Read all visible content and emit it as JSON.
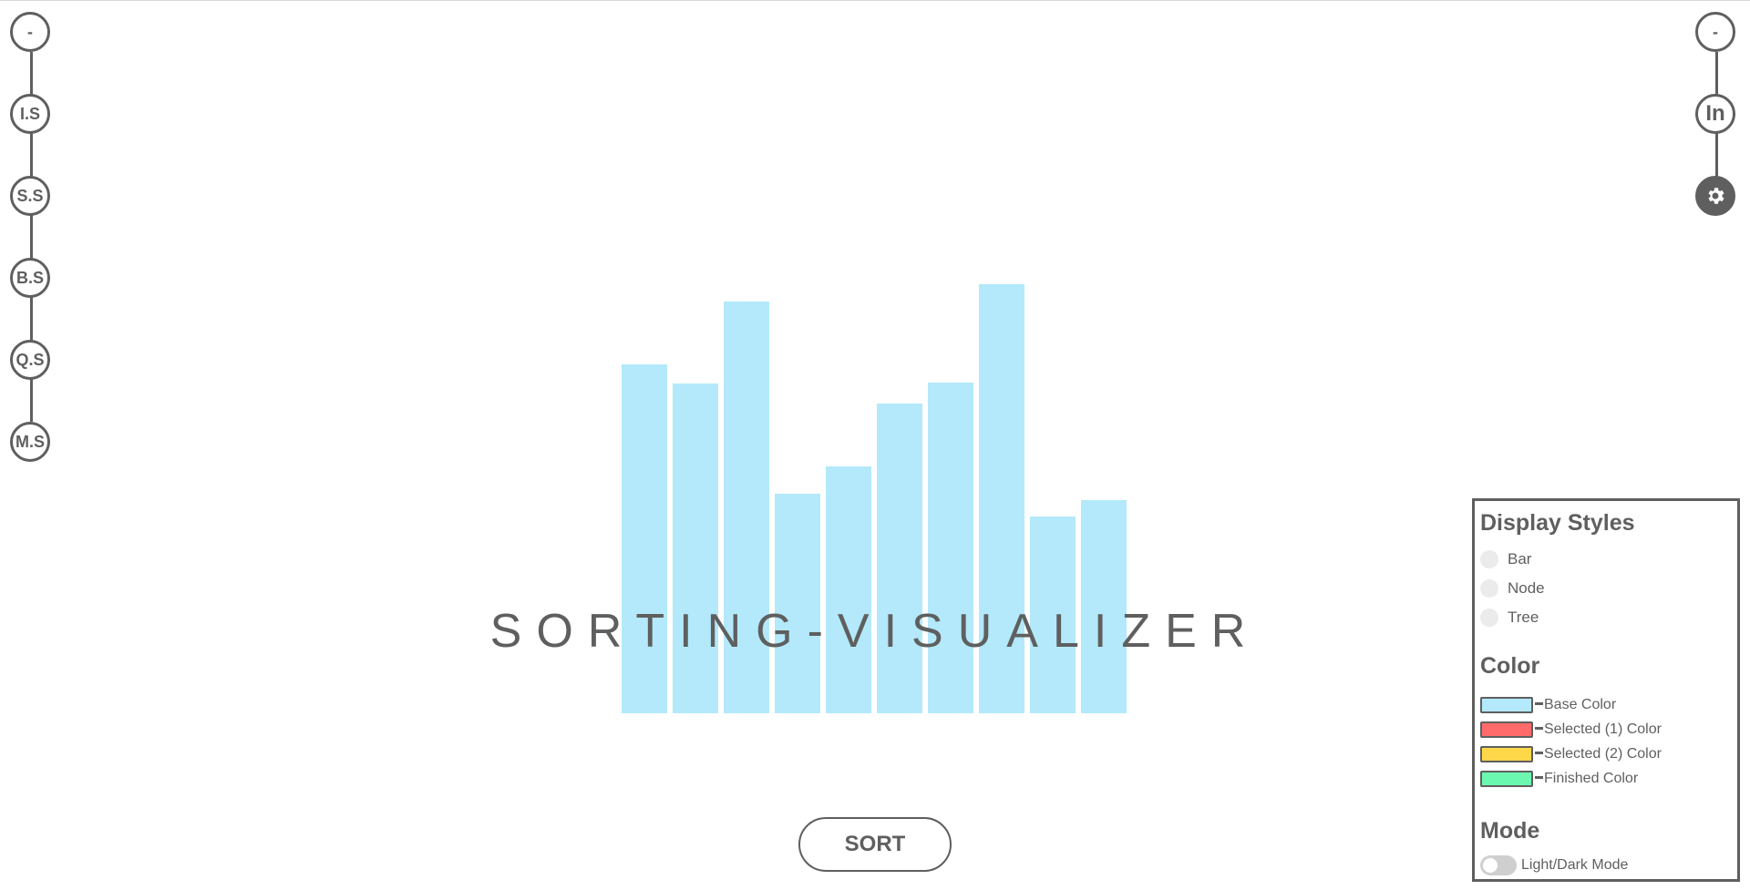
{
  "left_nav": {
    "items": [
      {
        "label": "-"
      },
      {
        "label": "I.S"
      },
      {
        "label": "S.S"
      },
      {
        "label": "B.S"
      },
      {
        "label": "Q.S"
      },
      {
        "label": "M.S"
      }
    ]
  },
  "right_nav": {
    "items": [
      {
        "label": "-"
      },
      {
        "label": "In"
      },
      {
        "icon": "gear-icon"
      }
    ]
  },
  "title": "SORTING-VISUALIZER",
  "sort_button": {
    "label": "SORT"
  },
  "bars": {
    "values": [
      383,
      362,
      452,
      241,
      271,
      340,
      363,
      471,
      216,
      234
    ],
    "color": "#b3e9fa"
  },
  "settings": {
    "display_styles": {
      "heading": "Display Styles",
      "options": [
        {
          "label": "Bar"
        },
        {
          "label": "Node"
        },
        {
          "label": "Tree"
        }
      ]
    },
    "color": {
      "heading": "Color",
      "items": [
        {
          "label": "Base Color",
          "value": "#b3e9fa"
        },
        {
          "label": "Selected (1) Color",
          "value": "#ff6b6b"
        },
        {
          "label": "Selected (2) Color",
          "value": "#ffd84a"
        },
        {
          "label": "Finished Color",
          "value": "#6cf7b0"
        }
      ]
    },
    "mode": {
      "heading": "Mode",
      "toggle_label": "Light/Dark Mode"
    }
  }
}
